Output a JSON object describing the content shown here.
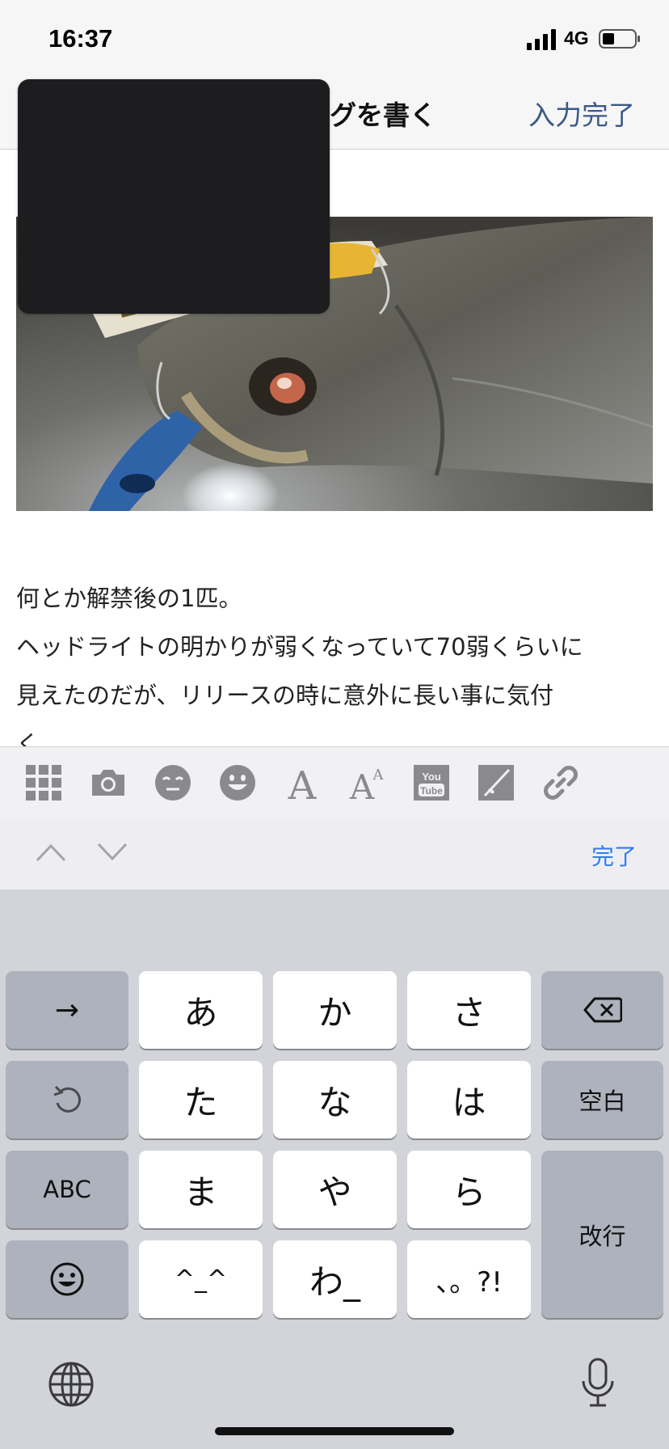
{
  "status": {
    "time": "16:37",
    "network": "4G"
  },
  "nav": {
    "title": "グを書く",
    "done_label": "入力完了"
  },
  "article": {
    "lines": [
      "何とか解禁後の1匹。",
      "ヘッドライトの明かりが弱くなっていて70弱くらいに",
      "見えたのだが、リリースの時に意外に長い事に気付",
      "く"
    ]
  },
  "format_toolbar": {
    "icons": [
      "grid-icon",
      "camera-icon",
      "emoticon-icon",
      "smiley-icon",
      "font-icon",
      "font-size-icon",
      "youtube-icon",
      "fishing-icon",
      "link-icon"
    ],
    "youtube_text_1": "You",
    "youtube_text_2": "Tube"
  },
  "accessory": {
    "done_label": "完了"
  },
  "keyboard": {
    "row1": [
      "→",
      "あ",
      "か",
      "さ"
    ],
    "row2": [
      "た",
      "な",
      "は",
      "空白"
    ],
    "row3": [
      "ABC",
      "ま",
      "や",
      "ら",
      "改行"
    ],
    "row4": [
      "^_^",
      "わ_",
      "、。?!"
    ]
  }
}
